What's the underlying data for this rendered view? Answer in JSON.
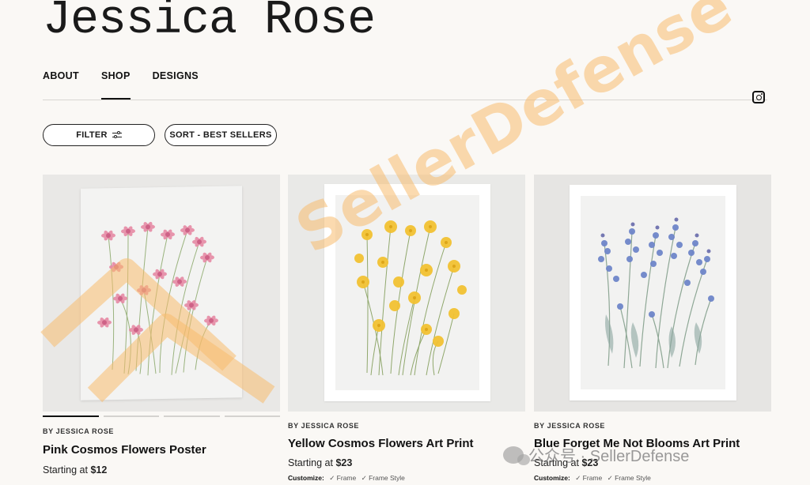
{
  "brand": {
    "name": "Jessica Rose"
  },
  "nav": {
    "items": [
      {
        "label": "ABOUT",
        "active": false
      },
      {
        "label": "SHOP",
        "active": true
      },
      {
        "label": "DESIGNS",
        "active": false
      }
    ]
  },
  "toolbar": {
    "filter_label": "FILTER",
    "sort_label": "SORT - BEST SELLERS"
  },
  "products": [
    {
      "by": "BY JESSICA ROSE",
      "title": "Pink Cosmos Flowers Poster",
      "price_prefix": "Starting at",
      "price": "$12",
      "flower_color": "#e07a9a"
    },
    {
      "by": "BY JESSICA ROSE",
      "title": "Yellow Cosmos Flowers Art Print",
      "price_prefix": "Starting at",
      "price": "$23",
      "customize_label": "Customize:",
      "options": [
        "✓ Frame",
        "✓ Frame Style"
      ],
      "flower_color": "#f0c02a"
    },
    {
      "by": "BY JESSICA ROSE",
      "title": "Blue Forget Me Not Blooms Art Print",
      "price_prefix": "Starting at",
      "price": "$23",
      "customize_label": "Customize:",
      "options": [
        "✓ Frame",
        "✓ Frame Style"
      ],
      "flower_color": "#6f86c9"
    }
  ],
  "watermark": {
    "text": "SellerDefense",
    "wechat_text": "公众号 · SellerDefense"
  }
}
